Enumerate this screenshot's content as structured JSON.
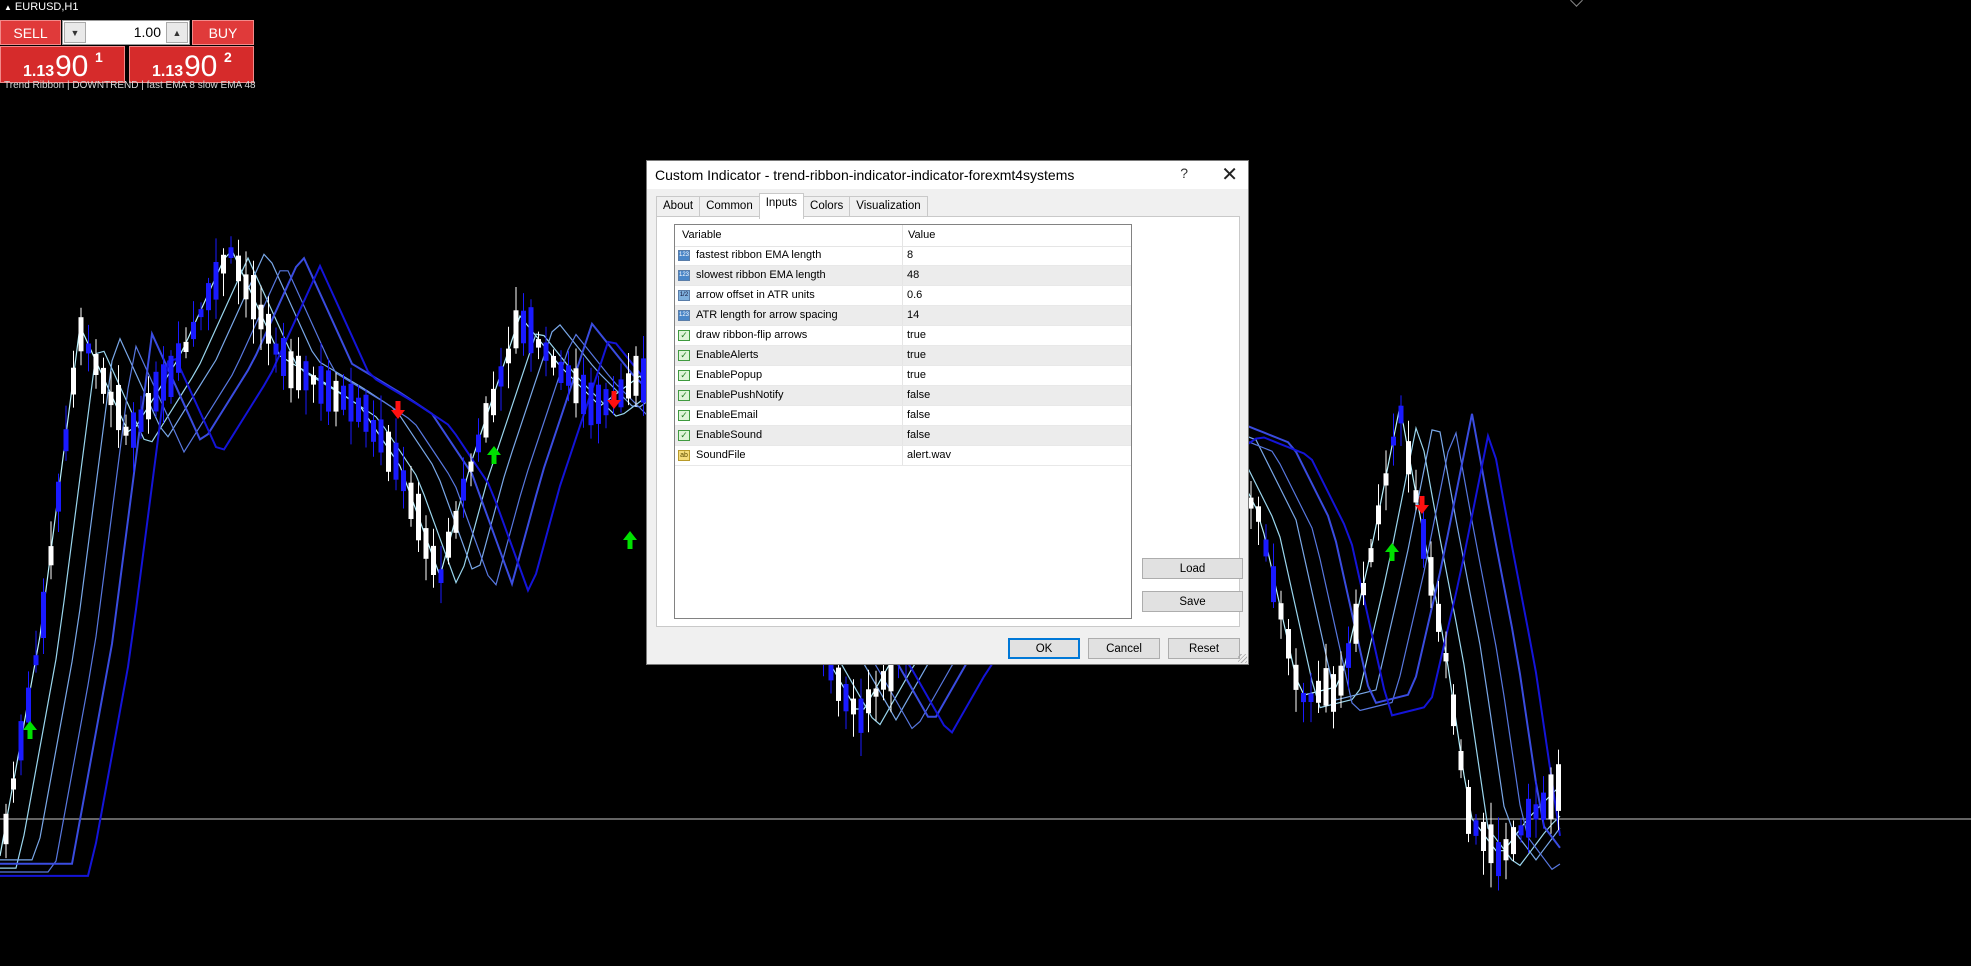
{
  "window": {
    "symbol_title": "EURUSD,H1"
  },
  "indicator_label": "Trend Ribbon | DOWNTREND | fast EMA 8 slow EMA 48",
  "trade_panel": {
    "sell_label": "SELL",
    "buy_label": "BUY",
    "lot": "1.00",
    "sell_price": {
      "prefix": "1.13",
      "big": "90",
      "sup": "1"
    },
    "buy_price": {
      "prefix": "1.13",
      "big": "90",
      "sup": "2"
    }
  },
  "dialog": {
    "title": "Custom Indicator - trend-ribbon-indicator-indicator-forexmt4systems",
    "help": "?",
    "close": "✕",
    "tabs": [
      "About",
      "Common",
      "Inputs",
      "Colors",
      "Visualization"
    ],
    "active_tab": "Inputs",
    "columns": {
      "variable": "Variable",
      "value": "Value"
    },
    "rows": [
      {
        "icon": "123",
        "type": "int",
        "variable": "fastest ribbon EMA length",
        "value": "8"
      },
      {
        "icon": "123",
        "type": "int",
        "variable": "slowest ribbon EMA length",
        "value": "48"
      },
      {
        "icon": "1/2",
        "type": "double",
        "variable": "arrow offset in ATR units",
        "value": "0.6"
      },
      {
        "icon": "123",
        "type": "int",
        "variable": "ATR length for arrow spacing",
        "value": "14"
      },
      {
        "icon": "✓",
        "type": "bool",
        "variable": "draw ribbon-flip arrows",
        "value": "true"
      },
      {
        "icon": "✓",
        "type": "bool",
        "variable": "EnableAlerts",
        "value": "true"
      },
      {
        "icon": "✓",
        "type": "bool",
        "variable": "EnablePopup",
        "value": "true"
      },
      {
        "icon": "✓",
        "type": "bool",
        "variable": "EnablePushNotify",
        "value": "false"
      },
      {
        "icon": "✓",
        "type": "bool",
        "variable": "EnableEmail",
        "value": "false"
      },
      {
        "icon": "✓",
        "type": "bool",
        "variable": "EnableSound",
        "value": "false"
      },
      {
        "icon": "ab",
        "type": "string",
        "variable": "SoundFile",
        "value": "alert.wav"
      }
    ],
    "buttons": {
      "load": "Load",
      "save": "Save",
      "ok": "OK",
      "cancel": "Cancel",
      "reset": "Reset"
    }
  },
  "colors": {
    "background": "#000000",
    "bull_candle": "#ffffff",
    "bear_candle": "#1a1aff",
    "ribbon_fast": "#b9f2ff",
    "ribbon_slow": "#1414d8",
    "arrow_up": "#00e000",
    "arrow_down": "#ff1010",
    "sell_buy": "#e03a3a"
  }
}
